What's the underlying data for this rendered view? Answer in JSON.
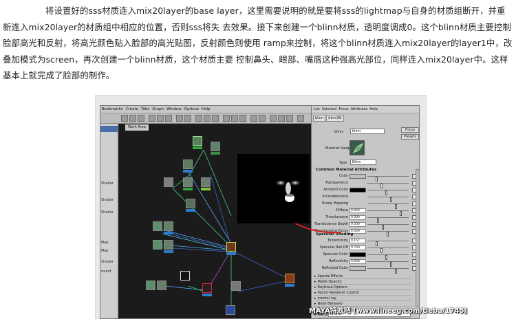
{
  "article": {
    "paragraph": "将设置好的sss材质连入mix20layer的base layer，这里需要说明的就是要将sss的lightmap与自身的材质组断开，并重新连入mix20layer的材质组中相应的位置，否则sss将失 去效果。接下来创建一个blinn材质，透明度调成0。这个blinn材质主要控制脸部高光和反射，将高光颜色贴入脸部的高光贴图，反射颜色则使用 ramp来控制，将这个blinn材质连入mix20layer的layer1中，改叠加模式为screen，再次创建一个blinn材质，这个材质主要 控制鼻头、眼部、嘴唇这种强高光部位，同样连入mix20layer中。这样基本上就完成了脸部的制作。"
  },
  "hypershade": {
    "menu": [
      "Bookmarks",
      "Create",
      "Tabs",
      "Graph",
      "Window",
      "Options",
      "Help"
    ],
    "work_area_tab": "Work Area",
    "left_rows": [
      "Shader",
      "Shader",
      "Shader",
      "Map",
      "Map",
      "Shader",
      "round",
      "ture"
    ]
  },
  "attribute_editor": {
    "menu": [
      "List",
      "Selected",
      "Focus",
      "Attributes",
      "Help"
    ],
    "tabs": [
      "blinn",
      "blinnSG"
    ],
    "blinn_label": "blinn:",
    "blinn_value": "blinn",
    "focus_button": "Focus",
    "presets_button": "Presets",
    "material_sample_label": "Material Sample",
    "type_label": "Type",
    "type_value": "Blinn",
    "common_section": "Common Material Attributes",
    "common_attrs": [
      {
        "label": "Color",
        "kind": "swatch"
      },
      {
        "label": "Transparency",
        "kind": "slider"
      },
      {
        "label": "Ambient Color",
        "kind": "color"
      },
      {
        "label": "Incandescence",
        "kind": "slider"
      },
      {
        "label": "Bump Mapping",
        "kind": "slider"
      },
      {
        "label": "Diffuse",
        "kind": "field",
        "value": "0.800"
      },
      {
        "label": "Translucence",
        "kind": "field",
        "value": "0.000"
      },
      {
        "label": "Translucence Depth",
        "kind": "field",
        "value": "0.500"
      },
      {
        "label": "Translucence Focus",
        "kind": "field",
        "value": "0.500"
      }
    ],
    "specular_section": "Specular Shading",
    "specular_attrs": [
      {
        "label": "Eccentricity",
        "kind": "field",
        "value": "0.157"
      },
      {
        "label": "Specular Roll Off",
        "kind": "field",
        "value": "0.700"
      },
      {
        "label": "Specular Color",
        "kind": "color"
      },
      {
        "label": "Reflectivity",
        "kind": "field",
        "value": "0.000"
      },
      {
        "label": "Reflected Color",
        "kind": "swatch"
      }
    ],
    "folds": [
      "Special Effects",
      "Matte Opacity",
      "Raytrace Options",
      "Vector Renderer Control",
      "mental ray",
      "Node Behavior",
      "Hardware Shading",
      "Hardware Texturing"
    ],
    "notes_label": "Notes:",
    "notes_value": "blinn1"
  },
  "watermark": "MAYA特效吧 [www.lineeg.com/tieba/1745]"
}
